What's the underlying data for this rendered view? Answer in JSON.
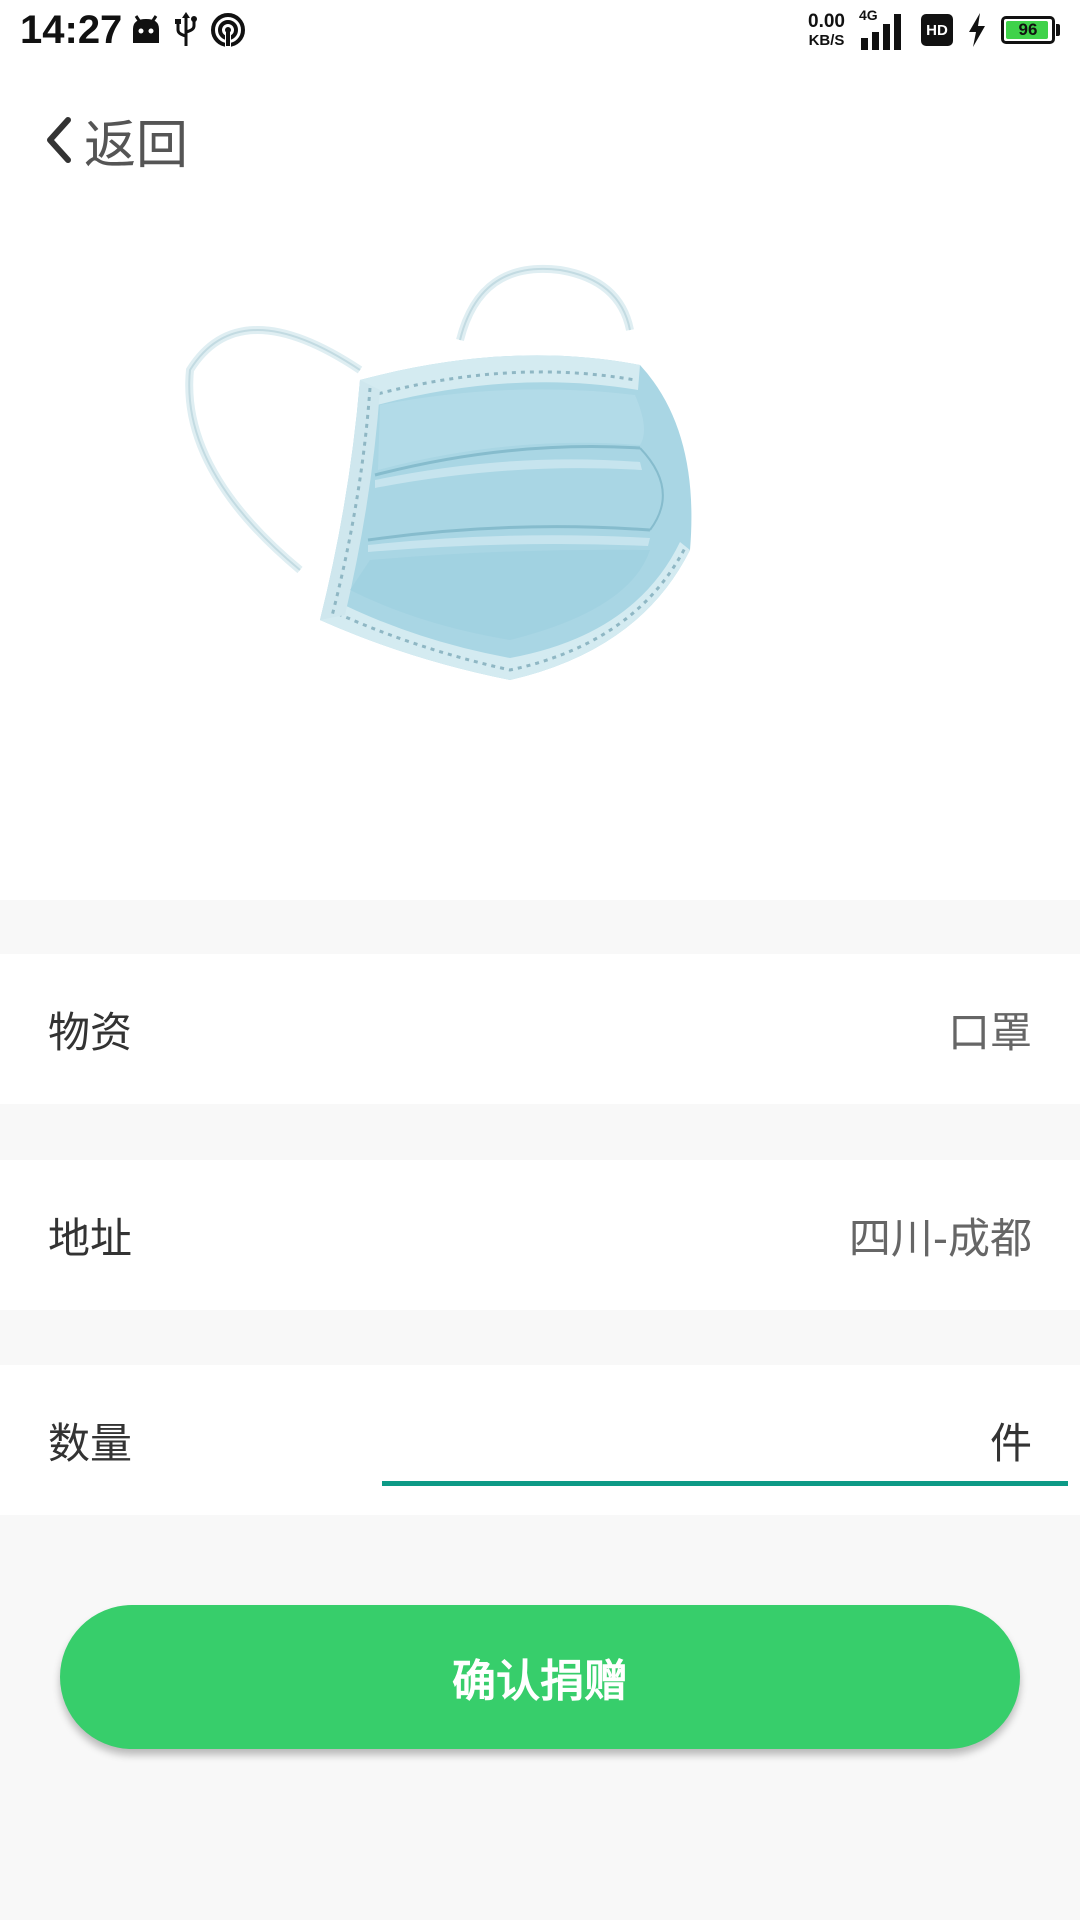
{
  "status_bar": {
    "time": "14:27",
    "net_speed_value": "0.00",
    "net_speed_unit": "KB/S",
    "network_type": "4G",
    "hd_label": "HD",
    "battery_level": "96",
    "battery_fraction": 0.96,
    "icons": [
      "android-icon",
      "usb-icon",
      "hotspot-icon",
      "signal-icon",
      "charging-icon",
      "battery-icon"
    ]
  },
  "header": {
    "back_label": "返回",
    "back_icon": "chevron-left-icon"
  },
  "product": {
    "image": "surgical-mask-image"
  },
  "form": {
    "material": {
      "label": "物资",
      "value": "口罩"
    },
    "address": {
      "label": "地址",
      "value": "四川-成都"
    },
    "quantity": {
      "label": "数量",
      "value": "",
      "unit": "件"
    }
  },
  "actions": {
    "confirm_label": "确认捐赠"
  },
  "colors": {
    "primary_button": "#37ce6b",
    "input_underline": "#0d9a86",
    "page_background": "#f8f8f8"
  }
}
